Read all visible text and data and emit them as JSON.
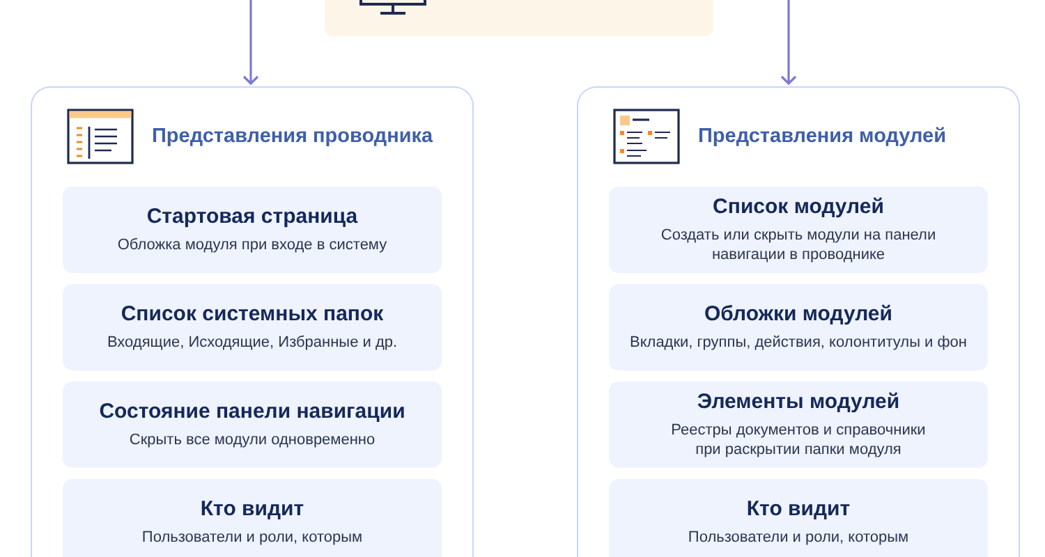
{
  "panels": [
    {
      "kind": "list",
      "title": "Представления проводника",
      "cards": [
        {
          "title": "Стартовая страница",
          "description": "Обложка модуля при входе в систему"
        },
        {
          "title": "Список системных папок",
          "description": "Входящие, Исходящие, Избранные и др."
        },
        {
          "title": "Состояние панели навигации",
          "description": "Скрыть все модули одновременно"
        },
        {
          "title": "Кто видит",
          "description": "Пользователи и роли, которым"
        }
      ]
    },
    {
      "kind": "grid",
      "title": "Представления модулей",
      "cards": [
        {
          "title": "Список модулей",
          "description": "Создать или скрыть модули на панели\nнавигации в проводнике"
        },
        {
          "title": "Обложки модулей",
          "description": "Вкладки, группы, действия, колонтитулы и фон"
        },
        {
          "title": "Элементы модулей",
          "description": "Реестры документов и справочники\nпри раскрытии папки модуля"
        },
        {
          "title": "Кто видит",
          "description": "Пользователи и роли, которым"
        }
      ]
    }
  ]
}
